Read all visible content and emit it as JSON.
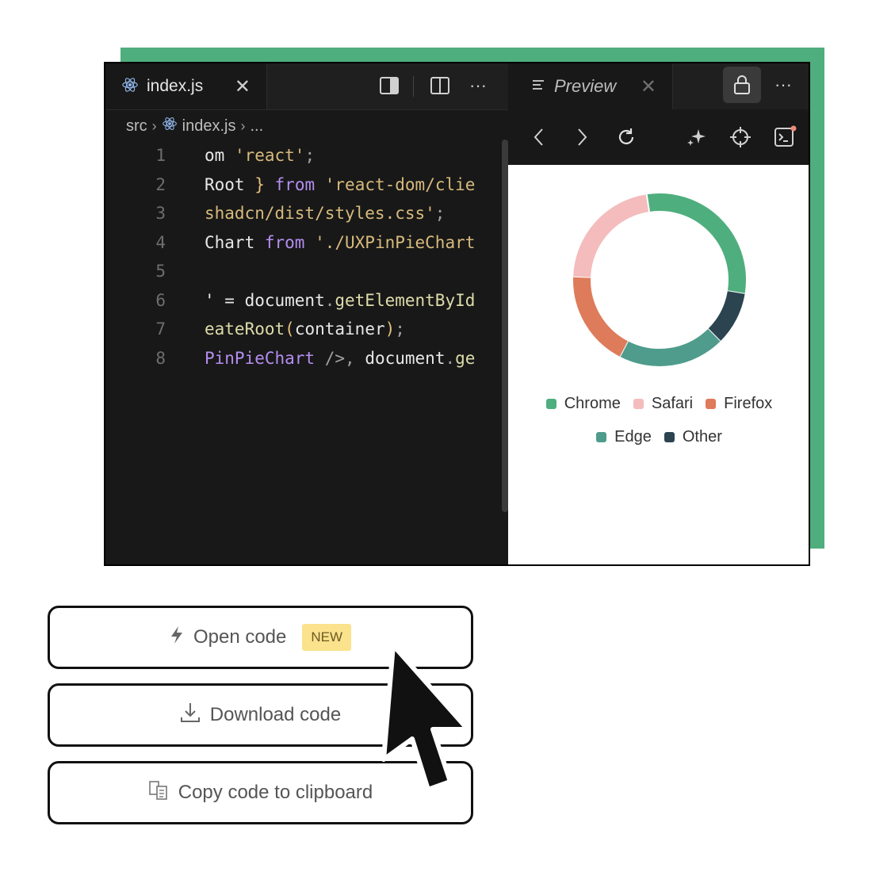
{
  "editor": {
    "tab_label": "index.js",
    "close_glyph": "✕",
    "breadcrumb": [
      "src",
      "index.js",
      "..."
    ],
    "line_numbers": [
      "1",
      "2",
      "3",
      "4",
      "5",
      "6",
      "7",
      "8"
    ],
    "code_lines": [
      [
        [
          "t-plain",
          "om "
        ],
        [
          "t-str",
          "'react'"
        ],
        [
          "t-punc",
          ";"
        ]
      ],
      [
        [
          "t-plain",
          "Root "
        ],
        [
          "t-brace",
          "}"
        ],
        [
          "t-plain",
          " "
        ],
        [
          "t-kw",
          "from"
        ],
        [
          "t-plain",
          " "
        ],
        [
          "t-str",
          "'react-dom/clie"
        ]
      ],
      [
        [
          "t-str",
          "shadcn/dist/styles.css'"
        ],
        [
          "t-punc",
          ";"
        ]
      ],
      [
        [
          "t-plain",
          "Chart "
        ],
        [
          "t-kw",
          "from"
        ],
        [
          "t-plain",
          " "
        ],
        [
          "t-str",
          "'./UXPinPieChart"
        ]
      ],
      [],
      [
        [
          "t-plain",
          "' = document"
        ],
        [
          "t-punc",
          "."
        ],
        [
          "t-fn",
          "getElementById"
        ]
      ],
      [
        [
          "t-fn",
          "eateRoot"
        ],
        [
          "t-brace",
          "("
        ],
        [
          "t-plain",
          "container"
        ],
        [
          "t-brace",
          ")"
        ],
        [
          "t-punc",
          ";"
        ]
      ],
      [
        [
          "t-kw",
          "PinPieChart"
        ],
        [
          "t-plain",
          " "
        ],
        [
          "t-punc",
          "/>,"
        ],
        [
          "t-plain",
          " document"
        ],
        [
          "t-punc",
          "."
        ],
        [
          "t-fn",
          "ge"
        ]
      ]
    ],
    "icons": [
      "react-icon",
      "split-panel-icon",
      "split-editor-icon",
      "more-icon"
    ]
  },
  "preview": {
    "tab_label": "Preview",
    "close_glyph": "✕",
    "icons": [
      "back-icon",
      "forward-icon",
      "reload-icon",
      "sparkle-icon",
      "target-icon",
      "terminal-icon",
      "lock-icon",
      "more-icon"
    ],
    "legend_row1": [
      "Chrome",
      "Safari",
      "Firefox"
    ],
    "legend_row2": [
      "Edge",
      "Other"
    ]
  },
  "chart_data": {
    "type": "pie",
    "variant": "donut",
    "series": [
      {
        "name": "Chrome",
        "value": 30,
        "color": "#4fae7d"
      },
      {
        "name": "Other",
        "value": 10,
        "color": "#2c4350"
      },
      {
        "name": "Edge",
        "value": 20,
        "color": "#4f9c8c"
      },
      {
        "name": "Firefox",
        "value": 18,
        "color": "#de7b5a"
      },
      {
        "name": "Safari",
        "value": 22,
        "color": "#f4bcbc"
      }
    ],
    "legend_position": "bottom"
  },
  "actions": {
    "open_label": "Open code",
    "open_badge": "NEW",
    "download_label": "Download code",
    "copy_label": "Copy code to clipboard"
  },
  "colors": {
    "accent_green": "#4fae7d",
    "editor_bg": "#181818",
    "badge_bg": "#fbe28c"
  }
}
